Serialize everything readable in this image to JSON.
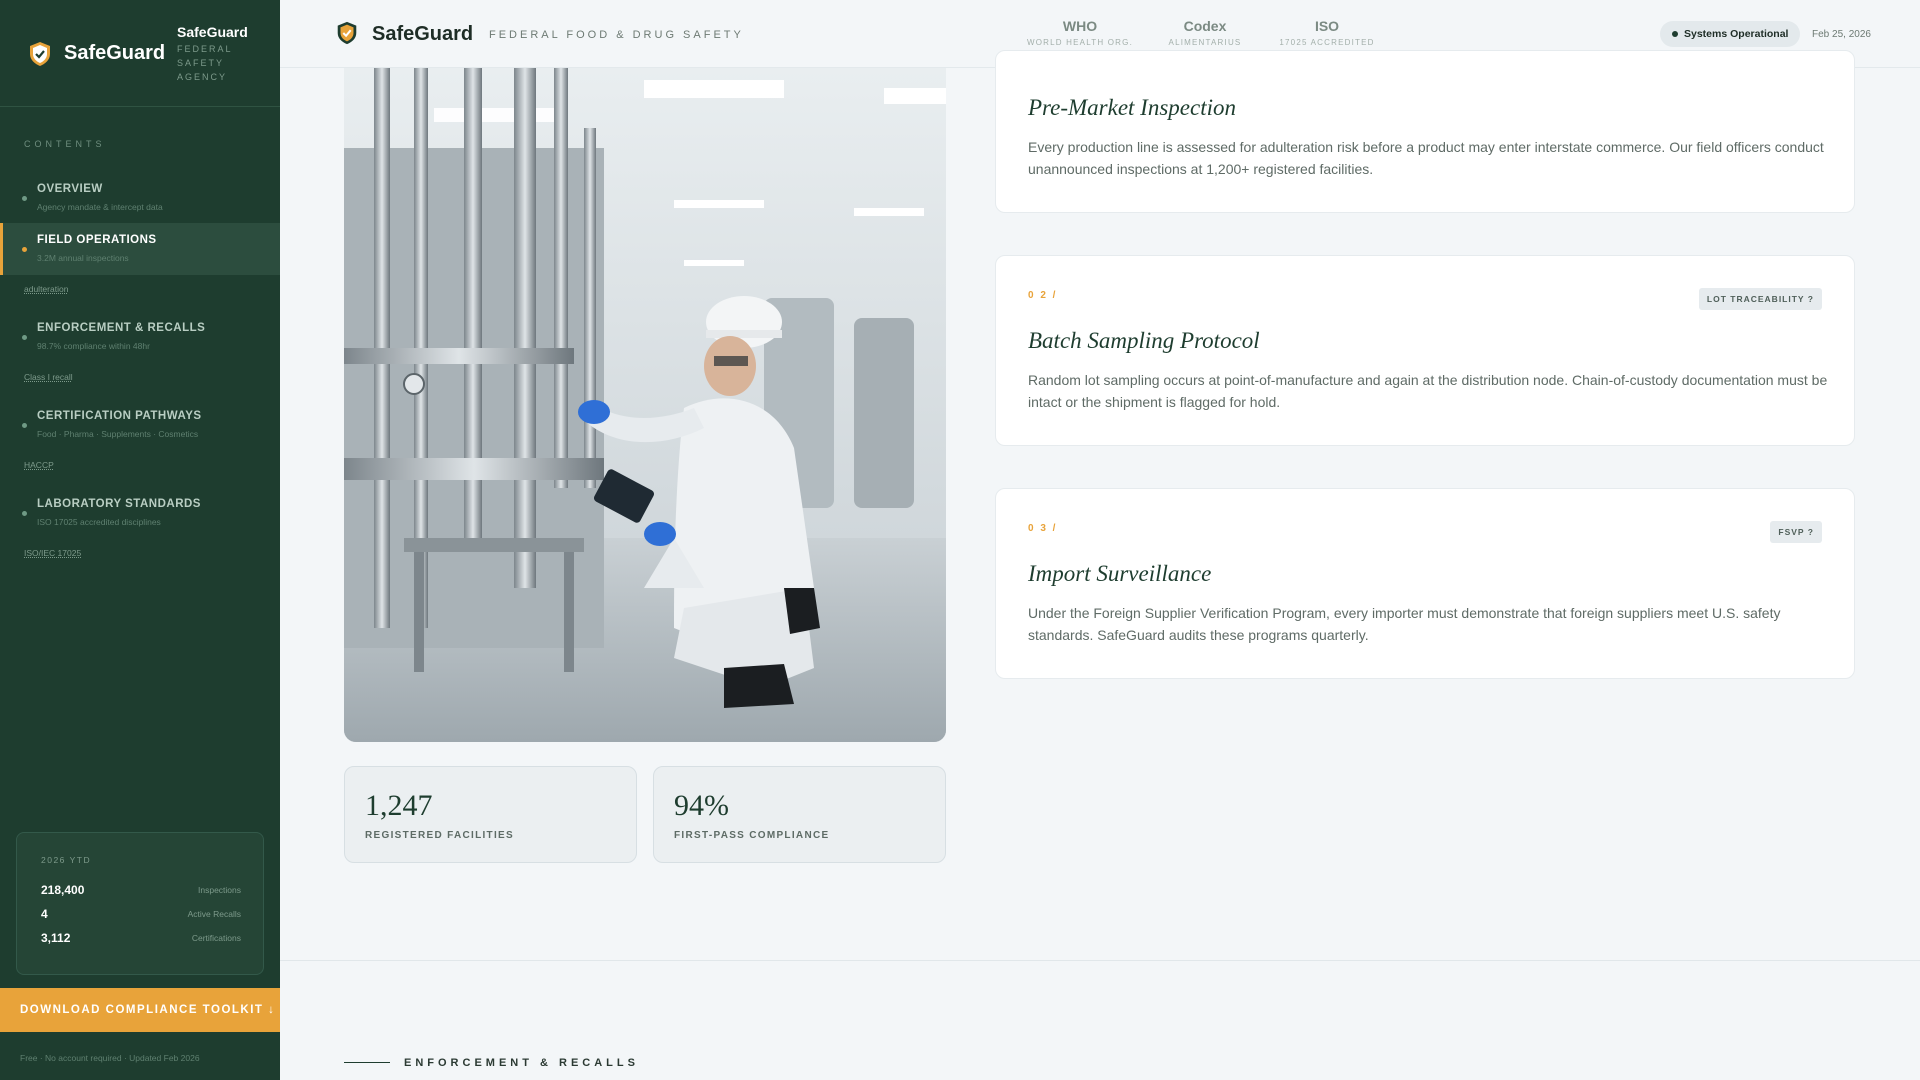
{
  "sidebar": {
    "brand_name": "SafeGuard",
    "brand_name_small": "SafeGuard",
    "brand_sub": "FEDERAL SAFETY AGENCY",
    "contents_label": "CONTENTS",
    "items": [
      {
        "title": "OVERVIEW",
        "desc": "Agency mandate & intercept data",
        "active": false
      },
      {
        "title": "FIELD OPERATIONS",
        "desc": "3.2M annual inspections",
        "active": true,
        "tag": "adulteration"
      },
      {
        "title": "ENFORCEMENT & RECALLS",
        "desc": "98.7% compliance within 48hr",
        "active": false,
        "tag": "Class I recall"
      },
      {
        "title": "CERTIFICATION PATHWAYS",
        "desc": "Food · Pharma · Supplements · Cosmetics",
        "active": false,
        "tag": "HACCP"
      },
      {
        "title": "LABORATORY STANDARDS",
        "desc": "ISO 17025 accredited disciplines",
        "active": false,
        "tag": "ISO/IEC 17025"
      }
    ],
    "ytd": {
      "label": "2026 YTD",
      "rows": [
        {
          "value": "218,400",
          "key": "Inspections"
        },
        {
          "value": "4",
          "key": "Active Recalls"
        },
        {
          "value": "3,112",
          "key": "Certifications"
        }
      ]
    },
    "download_label": "DOWNLOAD COMPLIANCE TOOLKIT ↓",
    "foot_note": "Free · No account required · Updated Feb 2026"
  },
  "header": {
    "brand_name": "SafeGuard",
    "tagline": "FEDERAL FOOD & DRUG SAFETY",
    "standards": [
      {
        "name": "WHO",
        "sub": "WORLD HEALTH ORG."
      },
      {
        "name": "Codex",
        "sub": "ALIMENTARIUS"
      },
      {
        "name": "ISO",
        "sub": "17025 ACCREDITED"
      }
    ],
    "status": "Systems Operational",
    "date": "Feb 25, 2026"
  },
  "main": {
    "stats": [
      {
        "value": "1,247",
        "label": "REGISTERED FACILITIES"
      },
      {
        "value": "94%",
        "label": "FIRST-PASS COMPLIANCE"
      }
    ],
    "cards": [
      {
        "num": "",
        "badge": "",
        "title": "Pre-Market Inspection",
        "body": "Every production line is assessed for adulteration risk before a product may enter interstate commerce. Our field officers conduct unannounced inspections at 1,200+ registered facilities."
      },
      {
        "num": "0 2  /",
        "badge": "LOT TRACEABILITY ?",
        "title": "Batch Sampling Protocol",
        "body": "Random lot sampling occurs at point-of-manufacture and again at the distribution node. Chain-of-custody documentation must be intact or the shipment is flagged for hold."
      },
      {
        "num": "0 3  /",
        "badge": "FSVP ?",
        "title": "Import Surveillance",
        "body": "Under the Foreign Supplier Verification Program, every importer must demonstrate that foreign suppliers meet U.S. safety standards. SafeGuard audits these programs quarterly."
      }
    ],
    "next_section": "ENFORCEMENT & RECALLS"
  },
  "colors": {
    "sidebar_bg": "#1e3d2f",
    "accent": "#e8a33a",
    "page_bg": "#f3f6f8"
  }
}
